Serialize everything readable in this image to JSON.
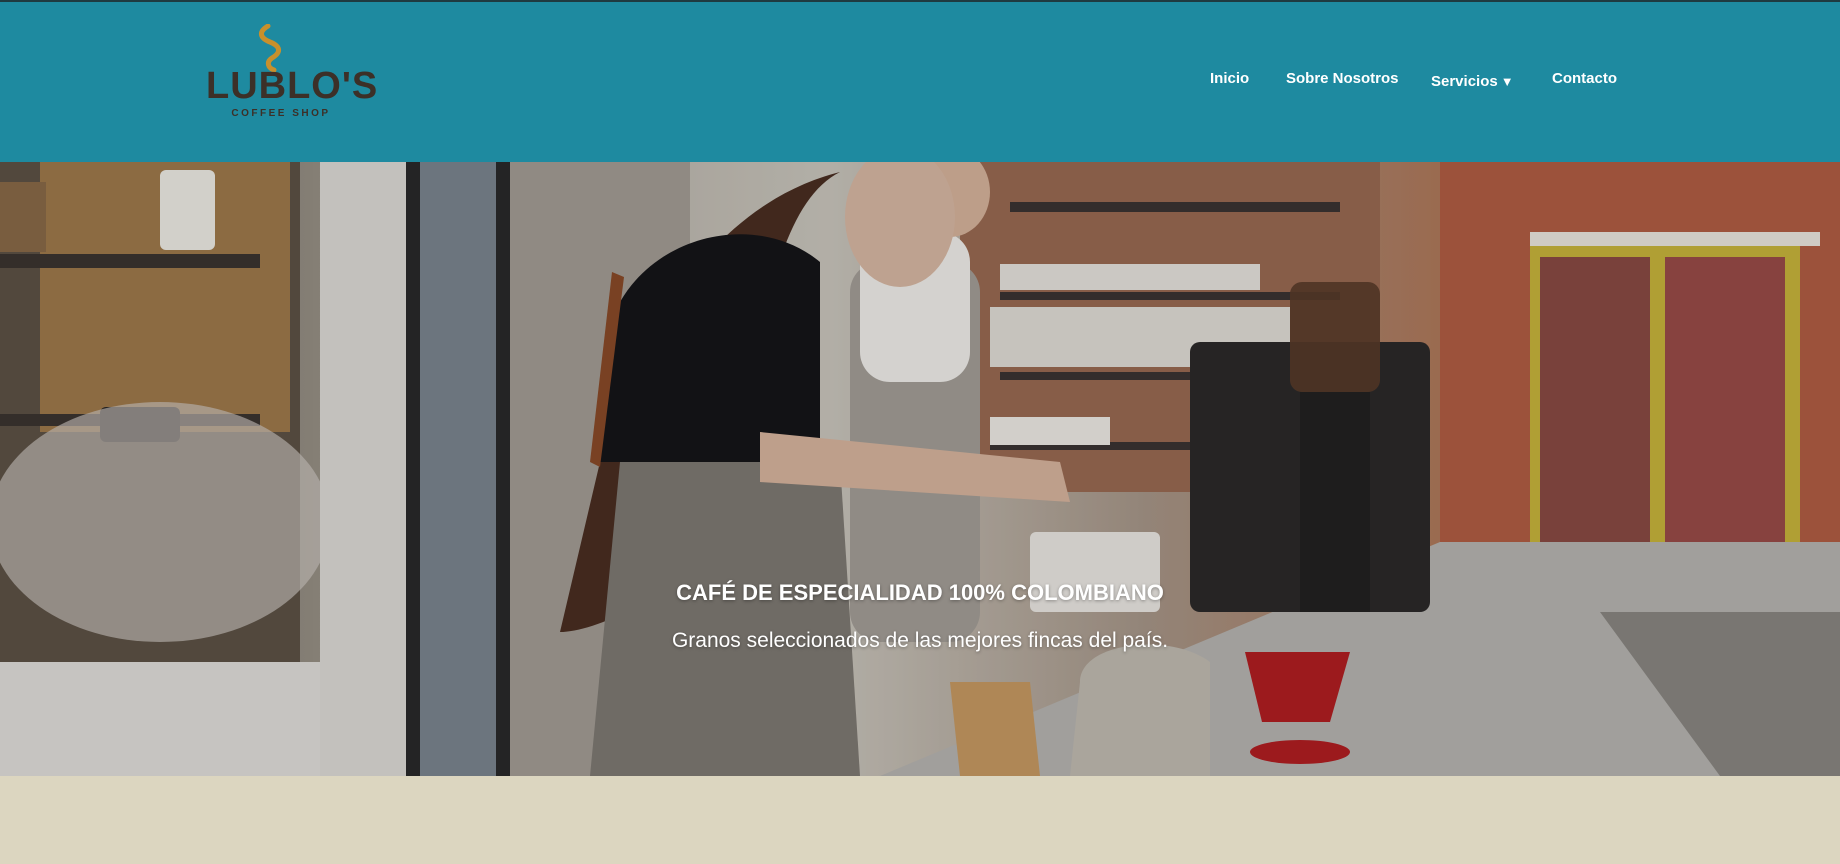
{
  "brand": {
    "name": "LUBLO'S",
    "tagline": "COFFEE SHOP"
  },
  "nav": {
    "items": [
      "Inicio",
      "Sobre Nosotros",
      "Servicios",
      "Contacto"
    ],
    "dropdown_caret": "▼"
  },
  "hero": {
    "title": "CAFÉ DE ESPECIALIDAD 100% COLOMBIANO",
    "subtitle": "Granos seleccionados de las mejores fincas del país."
  },
  "colors": {
    "header_bg": "#1e8aa0",
    "logo_text": "#3c3028",
    "logo_steam": "#c8902c",
    "page_bg": "#dcd6c0"
  },
  "icons": {
    "logo": "coffee-steam-icon",
    "dropdown": "caret-down-icon"
  }
}
